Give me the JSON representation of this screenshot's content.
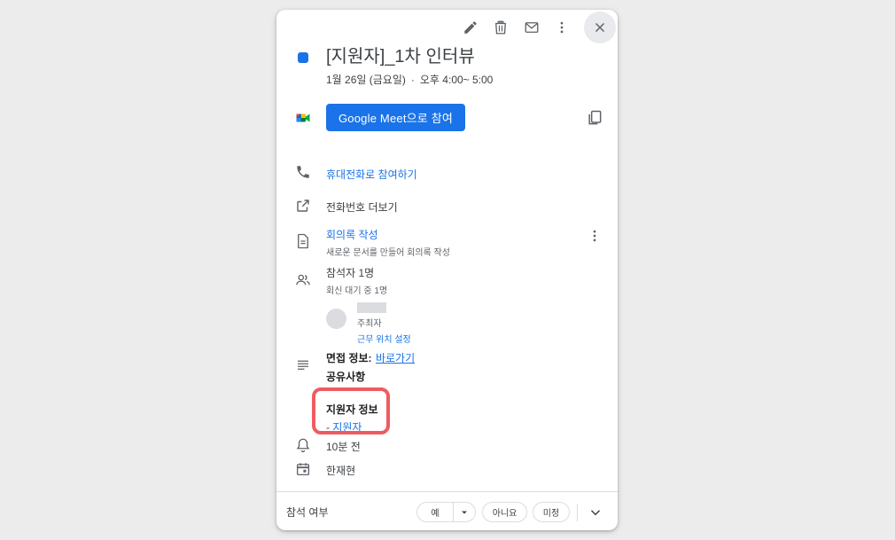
{
  "event": {
    "title": "[지원자]_1차 인터뷰",
    "date": "1월 26일 (금요일)",
    "separator": "·",
    "time": "오후 4:00~ 5:00",
    "color": "#1a73e8"
  },
  "meet": {
    "button_label": "Google Meet으로 참여"
  },
  "phone": {
    "label": "휴대전화로 참여하기"
  },
  "more_numbers": {
    "label": "전화번호 더보기"
  },
  "notes": {
    "title": "회의록 작성",
    "subtitle": "새로운 문서를 만들어 회의록 작성"
  },
  "guests": {
    "title": "참석자 1명",
    "subtitle": "회신 대기 중 1명",
    "organizer_role": "주최자",
    "work_location_link": "근무 위치 설정"
  },
  "description": {
    "interview_label": "면접 정보",
    "colon": ":",
    "interview_link": "바로가기",
    "shared_label": "공유사항",
    "applicant_label": "지원자 정보",
    "applicant_prefix": "- ",
    "applicant_link": "지원자"
  },
  "reminder": {
    "label": "10분 전"
  },
  "calendar": {
    "owner": "한재현"
  },
  "footer": {
    "label": "참석 여부",
    "yes": "예",
    "no": "아니요",
    "maybe": "미정"
  },
  "colors": {
    "accent": "#1a73e8",
    "highlight": "#ef5b61"
  }
}
